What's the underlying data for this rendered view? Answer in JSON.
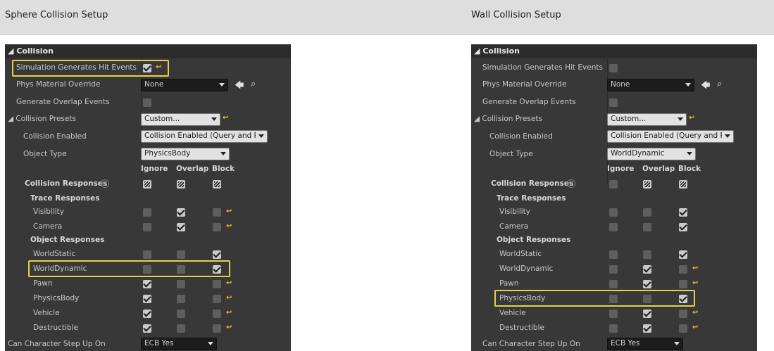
{
  "headers": {
    "left": "Sphere Collision Setup",
    "right": "Wall Collision Setup"
  },
  "colors": {
    "panel_bg": "#383838",
    "highlight": "#e8cf4a",
    "reset_arrow": "#e8c52a"
  },
  "icons": {
    "reset": "reset-arrow-icon",
    "browse": "arrow-left-icon",
    "find": "magnifier-icon",
    "help": "help-icon"
  },
  "reset_glyph": "↩",
  "panels": [
    {
      "category": "Collision",
      "sim_hit_label": "Simulation Generates Hit Events",
      "phys_material_label": "Phys Material Override",
      "phys_material_value": "None",
      "overlap_events_label": "Generate Overlap Events",
      "presets_label": "Collision Presets",
      "presets_value": "Custom...",
      "enabled_label": "Collision Enabled",
      "enabled_value": "Collision Enabled (Query and Pl",
      "object_type_label": "Object Type",
      "object_type_value": "PhysicsBody",
      "col_ignore": "Ignore",
      "col_overlap": "Overlap",
      "col_block": "Block",
      "responses_label": "Collision Responses",
      "trace_label": "Trace Responses",
      "object_label": "Object Responses",
      "rows": [
        {
          "label": "Visibility"
        },
        {
          "label": "Camera"
        },
        {
          "label": "WorldStatic"
        },
        {
          "label": "WorldDynamic"
        },
        {
          "label": "Pawn"
        },
        {
          "label": "PhysicsBody"
        },
        {
          "label": "Vehicle"
        },
        {
          "label": "Destructible"
        }
      ],
      "step_up_label": "Can Character Step Up On",
      "step_up_value": "ECB Yes"
    },
    {
      "category": "Collision",
      "sim_hit_label": "Simulation Generates Hit Events",
      "phys_material_label": "Phys Material Override",
      "phys_material_value": "None",
      "overlap_events_label": "Generate Overlap Events",
      "presets_label": "Collision Presets",
      "presets_value": "Custom...",
      "enabled_label": "Collision Enabled",
      "enabled_value": "Collision Enabled (Query and Pl",
      "object_type_label": "Object Type",
      "object_type_value": "WorldDynamic",
      "col_ignore": "Ignore",
      "col_overlap": "Overlap",
      "col_block": "Block",
      "responses_label": "Collision Responses",
      "trace_label": "Trace Responses",
      "object_label": "Object Responses",
      "rows": [
        {
          "label": "Visibility"
        },
        {
          "label": "Camera"
        },
        {
          "label": "WorldStatic"
        },
        {
          "label": "WorldDynamic"
        },
        {
          "label": "Pawn"
        },
        {
          "label": "PhysicsBody"
        },
        {
          "label": "Vehicle"
        },
        {
          "label": "Destructible"
        }
      ],
      "step_up_label": "Can Character Step Up On",
      "step_up_value": "ECB Yes"
    }
  ],
  "state": {
    "left": {
      "sim_hit": "checked",
      "overlap_events": "unchecked",
      "header_states": [
        "mixed",
        "mixed",
        "mixed"
      ],
      "rows": [
        [
          "unchecked",
          "checked",
          "unchecked"
        ],
        [
          "unchecked",
          "checked",
          "unchecked"
        ],
        [
          "unchecked",
          "unchecked",
          "checked"
        ],
        [
          "unchecked",
          "unchecked",
          "checked"
        ],
        [
          "checked",
          "unchecked",
          "unchecked"
        ],
        [
          "checked",
          "unchecked",
          "unchecked"
        ],
        [
          "checked",
          "unchecked",
          "unchecked"
        ],
        [
          "checked",
          "unchecked",
          "unchecked"
        ]
      ]
    },
    "right": {
      "sim_hit": "unchecked",
      "overlap_events": "unchecked",
      "header_states": [
        "unchecked",
        "mixed",
        "mixed"
      ],
      "rows": [
        [
          "unchecked",
          "unchecked",
          "checked"
        ],
        [
          "unchecked",
          "unchecked",
          "checked"
        ],
        [
          "unchecked",
          "unchecked",
          "checked"
        ],
        [
          "unchecked",
          "checked",
          "unchecked"
        ],
        [
          "unchecked",
          "checked",
          "unchecked"
        ],
        [
          "unchecked",
          "unchecked",
          "checked"
        ],
        [
          "unchecked",
          "checked",
          "unchecked"
        ],
        [
          "unchecked",
          "checked",
          "unchecked"
        ]
      ]
    }
  }
}
